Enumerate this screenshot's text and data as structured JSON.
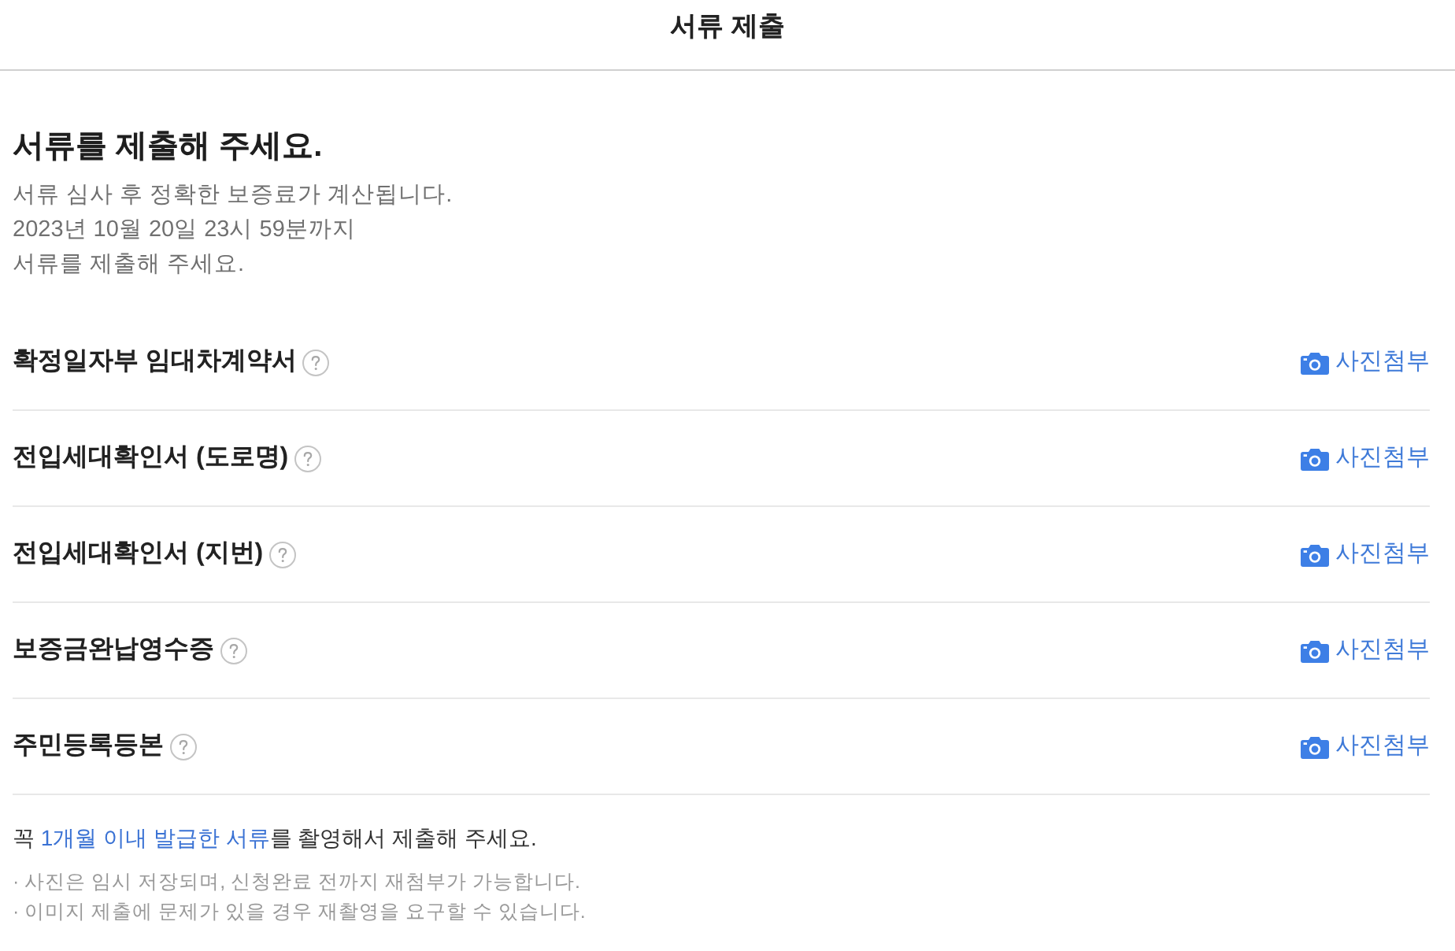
{
  "header": {
    "title": "서류 제출"
  },
  "intro": {
    "heading": "서류를 제출해 주세요.",
    "lines": [
      "서류 심사 후 정확한 보증료가 계산됩니다.",
      "2023년 10월 20일 23시 59분까지",
      "서류를 제출해 주세요."
    ]
  },
  "documents": [
    {
      "name": "확정일자부 임대차계약서",
      "action": "사진첨부"
    },
    {
      "name": "전입세대확인서 (도로명)",
      "action": "사진첨부"
    },
    {
      "name": "전입세대확인서 (지번)",
      "action": "사진첨부"
    },
    {
      "name": "보증금완납영수증",
      "action": "사진첨부"
    },
    {
      "name": "주민등록등본",
      "action": "사진첨부"
    }
  ],
  "notice": {
    "segments": [
      {
        "text": "꼭 ",
        "highlight": false
      },
      {
        "text": "1개월 이내 발급한 서류",
        "highlight": true
      },
      {
        "text": "를 촬영해서 제출해 주세요.",
        "highlight": false
      }
    ]
  },
  "notes": [
    "· 사진은 임시 저장되며, 신청완료 전까지 재첨부가 가능합니다.",
    "· 이미지 제출에 문제가 있을 경우 재촬영을 요구할 수 있습니다."
  ]
}
